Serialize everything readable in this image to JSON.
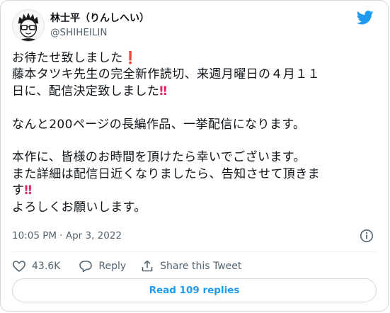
{
  "author": {
    "display_name": "林士平（りんしへい）",
    "handle": "@SHIHEILIN"
  },
  "tweet": {
    "lines": [
      {
        "text": "お待たせ致しました",
        "emoji": "❗"
      },
      {
        "text": "藤本タツキ先生の完全新作読切、来週月曜日の４月１１",
        "emoji": ""
      },
      {
        "text": "日に、配信決定致しました",
        "emoji": "‼"
      },
      {
        "text": "",
        "emoji": ""
      },
      {
        "text": "なんと200ページの長編作品、一挙配信になります。",
        "emoji": ""
      },
      {
        "text": "",
        "emoji": ""
      },
      {
        "text": "本作に、皆様のお時間を頂けたら幸いでございます。",
        "emoji": ""
      },
      {
        "text": "また詳細は配信日近くなりましたら、告知させて頂きま",
        "emoji": ""
      },
      {
        "text": "す",
        "emoji": "‼"
      },
      {
        "text": "よろしくお願いします。",
        "emoji": ""
      }
    ],
    "timestamp": "10:05 PM · Apr 3, 2022"
  },
  "actions": {
    "likes": "43.6K",
    "reply_label": "Reply",
    "share_label": "Share this Tweet"
  },
  "replies_button": "Read 109 replies",
  "icons": {
    "brand": "twitter-bird-icon",
    "info": "info-icon",
    "like": "heart-icon",
    "reply": "speech-bubble-icon",
    "share": "share-arrow-icon"
  },
  "colors": {
    "twitter_blue": "#1d9bf0",
    "text_primary": "#0f1419",
    "text_secondary": "#536471",
    "emoji_red": "#e0245e",
    "border": "#cfd9de"
  }
}
